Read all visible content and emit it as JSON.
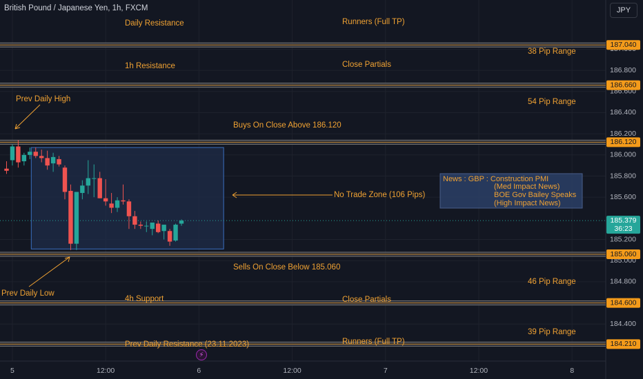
{
  "header": {
    "title": "British Pound / Japanese Yen, 1h, FXCM",
    "currency": "JPY"
  },
  "colors": {
    "background": "#131722",
    "grid": "#1e222d",
    "axis_text": "#b2b5be",
    "annotation": "#f0a233",
    "level_line": "#7a7a7a",
    "bull": "#26a69a",
    "bear": "#ef5350",
    "zone_fill": "#1f2c48",
    "zone_border": "#3a6fc0",
    "price_badge": "#f49b1a",
    "current_badge": "#26a69a"
  },
  "chart_data": {
    "type": "candlestick",
    "symbol": "GBPJPY",
    "timeframe": "1h",
    "ylim": [
      184.03,
      187.27
    ],
    "y_ticks": [
      187.0,
      186.8,
      186.6,
      186.4,
      186.2,
      186.0,
      185.8,
      185.6,
      185.2,
      185.0,
      184.8,
      184.6,
      184.4
    ],
    "x_ticks": [
      {
        "label": "5",
        "bar": 1
      },
      {
        "label": "12:00",
        "bar": 17
      },
      {
        "label": "6",
        "bar": 33
      },
      {
        "label": "12:00",
        "bar": 49
      },
      {
        "label": "7",
        "bar": 65
      },
      {
        "label": "12:00",
        "bar": 81
      },
      {
        "label": "8",
        "bar": 97
      }
    ],
    "candles": [
      {
        "o": 185.87,
        "h": 185.94,
        "l": 185.82,
        "c": 185.85
      },
      {
        "o": 185.95,
        "h": 186.1,
        "l": 185.9,
        "c": 186.08
      },
      {
        "o": 186.08,
        "h": 186.14,
        "l": 185.88,
        "c": 185.93
      },
      {
        "o": 185.94,
        "h": 186.02,
        "l": 185.9,
        "c": 186.0
      },
      {
        "o": 186.0,
        "h": 186.07,
        "l": 185.96,
        "c": 186.03
      },
      {
        "o": 186.03,
        "h": 186.07,
        "l": 185.97,
        "c": 185.99
      },
      {
        "o": 185.99,
        "h": 186.05,
        "l": 185.93,
        "c": 185.97
      },
      {
        "o": 185.97,
        "h": 186.04,
        "l": 185.86,
        "c": 185.9
      },
      {
        "o": 185.92,
        "h": 186.02,
        "l": 185.84,
        "c": 185.98
      },
      {
        "o": 185.96,
        "h": 185.99,
        "l": 185.89,
        "c": 185.91
      },
      {
        "o": 185.88,
        "h": 185.9,
        "l": 185.58,
        "c": 185.65
      },
      {
        "o": 185.66,
        "h": 185.72,
        "l": 185.1,
        "c": 185.16
      },
      {
        "o": 185.16,
        "h": 185.65,
        "l": 185.1,
        "c": 185.65
      },
      {
        "o": 185.64,
        "h": 185.76,
        "l": 185.58,
        "c": 185.71
      },
      {
        "o": 185.71,
        "h": 185.95,
        "l": 185.63,
        "c": 185.78
      },
      {
        "o": 185.78,
        "h": 185.91,
        "l": 185.6,
        "c": 185.78
      },
      {
        "o": 185.78,
        "h": 185.84,
        "l": 185.59,
        "c": 185.59
      },
      {
        "o": 185.59,
        "h": 185.77,
        "l": 185.52,
        "c": 185.56
      },
      {
        "o": 185.54,
        "h": 185.64,
        "l": 185.45,
        "c": 185.5
      },
      {
        "o": 185.5,
        "h": 185.6,
        "l": 185.46,
        "c": 185.57
      },
      {
        "o": 185.57,
        "h": 185.72,
        "l": 185.53,
        "c": 185.56
      },
      {
        "o": 185.56,
        "h": 185.58,
        "l": 185.3,
        "c": 185.42
      },
      {
        "o": 185.42,
        "h": 185.47,
        "l": 185.3,
        "c": 185.34
      },
      {
        "o": 185.34,
        "h": 185.37,
        "l": 185.3,
        "c": 185.33
      },
      {
        "o": 185.33,
        "h": 185.37,
        "l": 185.27,
        "c": 185.33
      },
      {
        "o": 185.3,
        "h": 185.36,
        "l": 185.24,
        "c": 185.36
      },
      {
        "o": 185.35,
        "h": 185.38,
        "l": 185.26,
        "c": 185.27
      },
      {
        "o": 185.28,
        "h": 185.34,
        "l": 185.2,
        "c": 185.34
      },
      {
        "o": 185.28,
        "h": 185.3,
        "l": 185.14,
        "c": 185.18
      },
      {
        "o": 185.19,
        "h": 185.35,
        "l": 185.18,
        "c": 185.34
      },
      {
        "o": 185.35,
        "h": 185.39,
        "l": 185.33,
        "c": 185.379
      }
    ],
    "current_price": {
      "value": "185.379",
      "countdown": "36:23",
      "price": 185.379
    },
    "levels": [
      {
        "price": 187.04,
        "label": "187.040"
      },
      {
        "price": 186.66,
        "label": "186.660"
      },
      {
        "price": 186.12,
        "label": "186.120"
      },
      {
        "price": 185.06,
        "label": "185.060"
      },
      {
        "price": 184.6,
        "label": "184.600"
      },
      {
        "price": 184.21,
        "label": "184.210"
      }
    ],
    "no_trade_zone": {
      "from_bar": 4,
      "to_bar": 37,
      "high": 186.07,
      "low": 185.11
    },
    "annotations": {
      "daily_resistance": "Daily Resistance",
      "runners_top": "Runners (Full TP)",
      "range_38": "38 Pip Range",
      "h1_resistance": "1h Resistance",
      "close_partials_top": "Close Partials",
      "prev_daily_high": "Prev Daily High",
      "range_54": "54 Pip Range",
      "buys": "Buys On Close Above 186.120",
      "no_trade_zone": "No Trade Zone (106 Pips)",
      "sells": "Sells On Close Below 185.060",
      "prev_daily_low": "Prev Daily Low",
      "range_46": "46 Pip Range",
      "h4_support": "4h Support",
      "close_partials_bottom": "Close Partials",
      "range_39": "39 Pip Range",
      "prev_daily_resistance": "Prev Daily Resistance (23.11.2023)",
      "runners_bottom": "Runners (Full TP)"
    },
    "news": {
      "lines": [
        "News : GBP : Construction PMI",
        "(Med Impact News)",
        "BOE Gov Bailey Speaks",
        "(High Impact News)"
      ]
    }
  }
}
